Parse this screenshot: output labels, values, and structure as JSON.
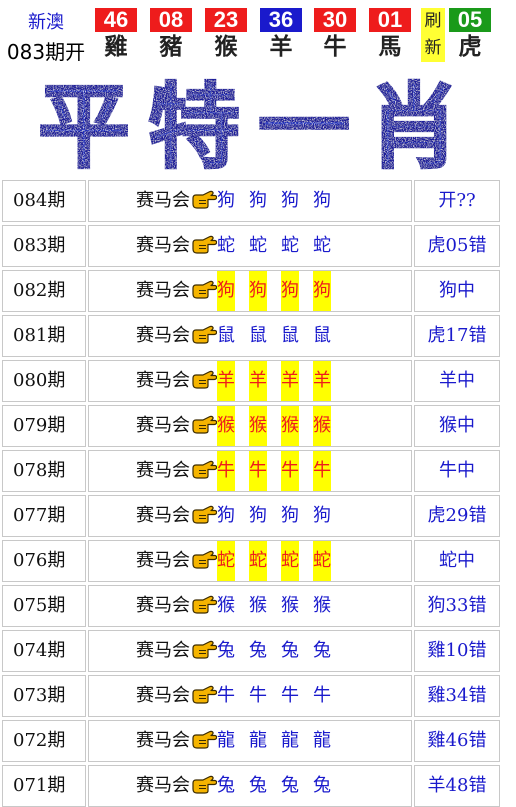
{
  "header": {
    "region": "新澳",
    "issue": "083期开",
    "balls": [
      {
        "number": "46",
        "zodiac": "雞",
        "color": "red"
      },
      {
        "number": "08",
        "zodiac": "豬",
        "color": "red"
      },
      {
        "number": "23",
        "zodiac": "猴",
        "color": "red"
      },
      {
        "number": "36",
        "zodiac": "羊",
        "color": "blue"
      },
      {
        "number": "30",
        "zodiac": "牛",
        "color": "red"
      },
      {
        "number": "01",
        "zodiac": "馬",
        "color": "red"
      }
    ],
    "refresh_line1": "刷",
    "refresh_line2": "新",
    "special": {
      "number": "05",
      "zodiac": "虎",
      "color": "green"
    }
  },
  "banner": {
    "title": "平特一肖"
  },
  "colors": {
    "red": "#ee1c1c",
    "blue": "#1a1acc",
    "green": "#1a9a1a",
    "highlight": "#ffff00"
  },
  "source_label": "赛马会",
  "pointer_icon": "pointing-hand-icon",
  "records": [
    {
      "issue": "084期",
      "picks": [
        "狗",
        "狗",
        "狗",
        "狗"
      ],
      "hit": false,
      "result": "开??"
    },
    {
      "issue": "083期",
      "picks": [
        "蛇",
        "蛇",
        "蛇",
        "蛇"
      ],
      "hit": false,
      "result": "虎05错"
    },
    {
      "issue": "082期",
      "picks": [
        "狗",
        "狗",
        "狗",
        "狗"
      ],
      "hit": true,
      "result": "狗中"
    },
    {
      "issue": "081期",
      "picks": [
        "鼠",
        "鼠",
        "鼠",
        "鼠"
      ],
      "hit": false,
      "result": "虎17错"
    },
    {
      "issue": "080期",
      "picks": [
        "羊",
        "羊",
        "羊",
        "羊"
      ],
      "hit": true,
      "result": "羊中"
    },
    {
      "issue": "079期",
      "picks": [
        "猴",
        "猴",
        "猴",
        "猴"
      ],
      "hit": true,
      "result": "猴中"
    },
    {
      "issue": "078期",
      "picks": [
        "牛",
        "牛",
        "牛",
        "牛"
      ],
      "hit": true,
      "result": "牛中"
    },
    {
      "issue": "077期",
      "picks": [
        "狗",
        "狗",
        "狗",
        "狗"
      ],
      "hit": false,
      "result": "虎29错"
    },
    {
      "issue": "076期",
      "picks": [
        "蛇",
        "蛇",
        "蛇",
        "蛇"
      ],
      "hit": true,
      "result": "蛇中"
    },
    {
      "issue": "075期",
      "picks": [
        "猴",
        "猴",
        "猴",
        "猴"
      ],
      "hit": false,
      "result": "狗33错"
    },
    {
      "issue": "074期",
      "picks": [
        "兔",
        "兔",
        "兔",
        "兔"
      ],
      "hit": false,
      "result": "雞10错"
    },
    {
      "issue": "073期",
      "picks": [
        "牛",
        "牛",
        "牛",
        "牛"
      ],
      "hit": false,
      "result": "雞34错"
    },
    {
      "issue": "072期",
      "picks": [
        "龍",
        "龍",
        "龍",
        "龍"
      ],
      "hit": false,
      "result": "雞46错"
    },
    {
      "issue": "071期",
      "picks": [
        "兔",
        "兔",
        "兔",
        "兔"
      ],
      "hit": false,
      "result": "羊48错"
    }
  ]
}
